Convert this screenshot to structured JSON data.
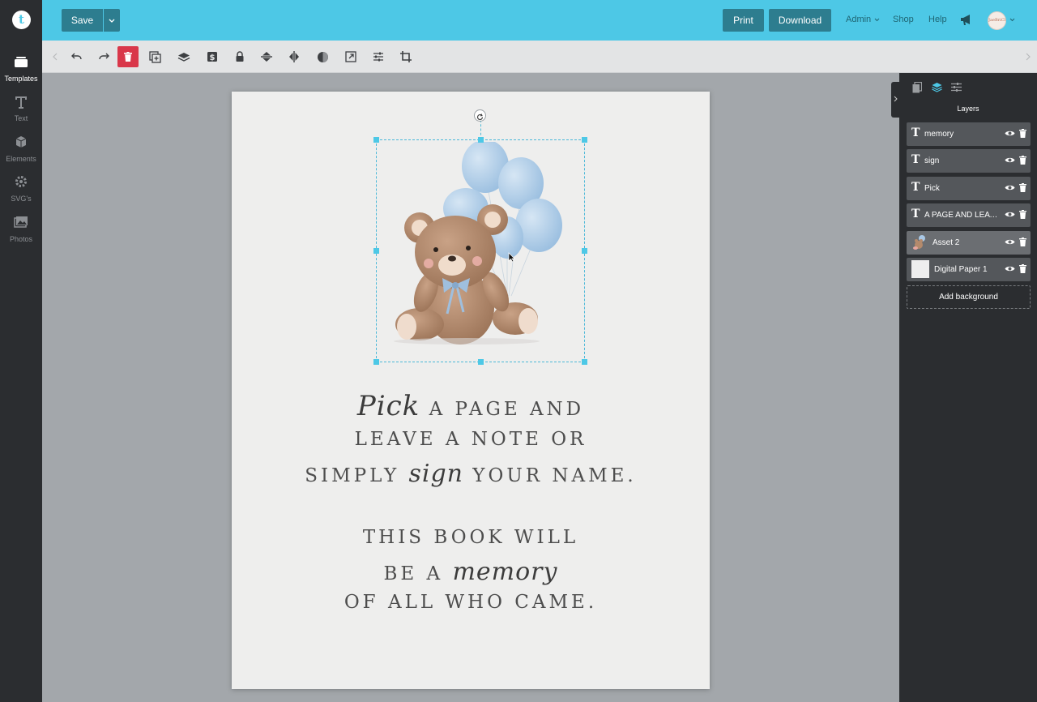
{
  "rail": {
    "items": [
      {
        "label": "Templates"
      },
      {
        "label": "Text"
      },
      {
        "label": "Elements"
      },
      {
        "label": "SVG's"
      },
      {
        "label": "Photos"
      }
    ]
  },
  "topbar": {
    "save_label": "Save",
    "print_label": "Print",
    "download_label": "Download",
    "admin_label": "Admin",
    "shop_label": "Shop",
    "help_label": "Help",
    "avatar_text": "JaeBriClore",
    "accent": "#4dc8e6"
  },
  "canvas": {
    "pick": "Pick",
    "line1_rest": "A PAGE AND",
    "line2": "LEAVE A NOTE OR",
    "line3_a": "SIMPLY",
    "sign": "sign",
    "line3_b": "YOUR NAME.",
    "line4": "THIS BOOK WILL",
    "line5_a": "BE A",
    "memory": "memory",
    "line6": "OF ALL WHO CAME."
  },
  "layers_panel": {
    "title": "Layers",
    "layers": [
      {
        "name": "memory",
        "kind": "text"
      },
      {
        "name": "sign",
        "kind": "text"
      },
      {
        "name": "Pick",
        "kind": "text"
      },
      {
        "name": "A PAGE AND LEAVE A NOTE OR SIMPLY",
        "kind": "text"
      },
      {
        "name": "Asset 2",
        "kind": "image"
      },
      {
        "name": "Digital Paper 1",
        "kind": "image"
      }
    ],
    "add_background_label": "Add background"
  }
}
